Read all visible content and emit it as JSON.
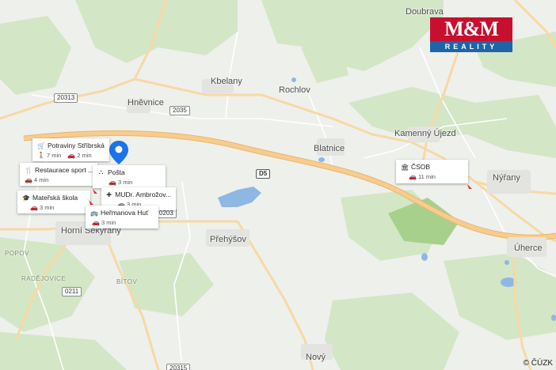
{
  "places": {
    "doubrava": "Doubrava",
    "kbelany": "Kbelany",
    "hnevnice": "Hněvnice",
    "rochlov": "Rochlov",
    "kamenny_ujezd": "Kamenný Újezd",
    "blatnice": "Blatnice",
    "nyrany": "Nýřany",
    "prehysov": "Přehýšov",
    "uherce": "Úherce",
    "horni_sekyrany": "Horní Sekyrany",
    "novy": "Nový",
    "popov": "POPOV",
    "radejovice": "RADĚJOVICE",
    "bitov": "BÍTOV"
  },
  "road_shields": {
    "r20313": "20313",
    "r2035": "2035",
    "d5": "D5",
    "r0211": "0211",
    "r20315": "20315",
    "r0203": "0203"
  },
  "pois": [
    {
      "name": "Potraviny Stříbrská",
      "icon": "shopping-cart-icon",
      "walk": "7 min",
      "drive": "2 min"
    },
    {
      "name": "Restaurace sport ...",
      "icon": "restaurant-icon",
      "drive": "4 min"
    },
    {
      "name": "Pošta",
      "icon": "post-office-icon",
      "drive": "3 min"
    },
    {
      "name": "MUDr. Ambrožov...",
      "icon": "doctor-icon",
      "drive": "3 min"
    },
    {
      "name": "Mateřská škola",
      "icon": "school-icon",
      "drive": "3 min"
    },
    {
      "name": "Heřmanova Huť",
      "icon": "bus-stop-icon",
      "drive": "3 min"
    },
    {
      "name": "ČSOB",
      "icon": "bank-icon",
      "drive": "11 min"
    }
  ],
  "logo": {
    "line1": "M&M",
    "line2": "REALITY",
    "red": "#c8102e",
    "blue": "#1f64a8"
  },
  "attribution": "© ČÚZK",
  "colors": {
    "pin": "#1a73e8",
    "highway": "#f6c987",
    "road": "#fbe2b3",
    "water": "#8fb7e3",
    "forest": "#cfe3c4"
  }
}
